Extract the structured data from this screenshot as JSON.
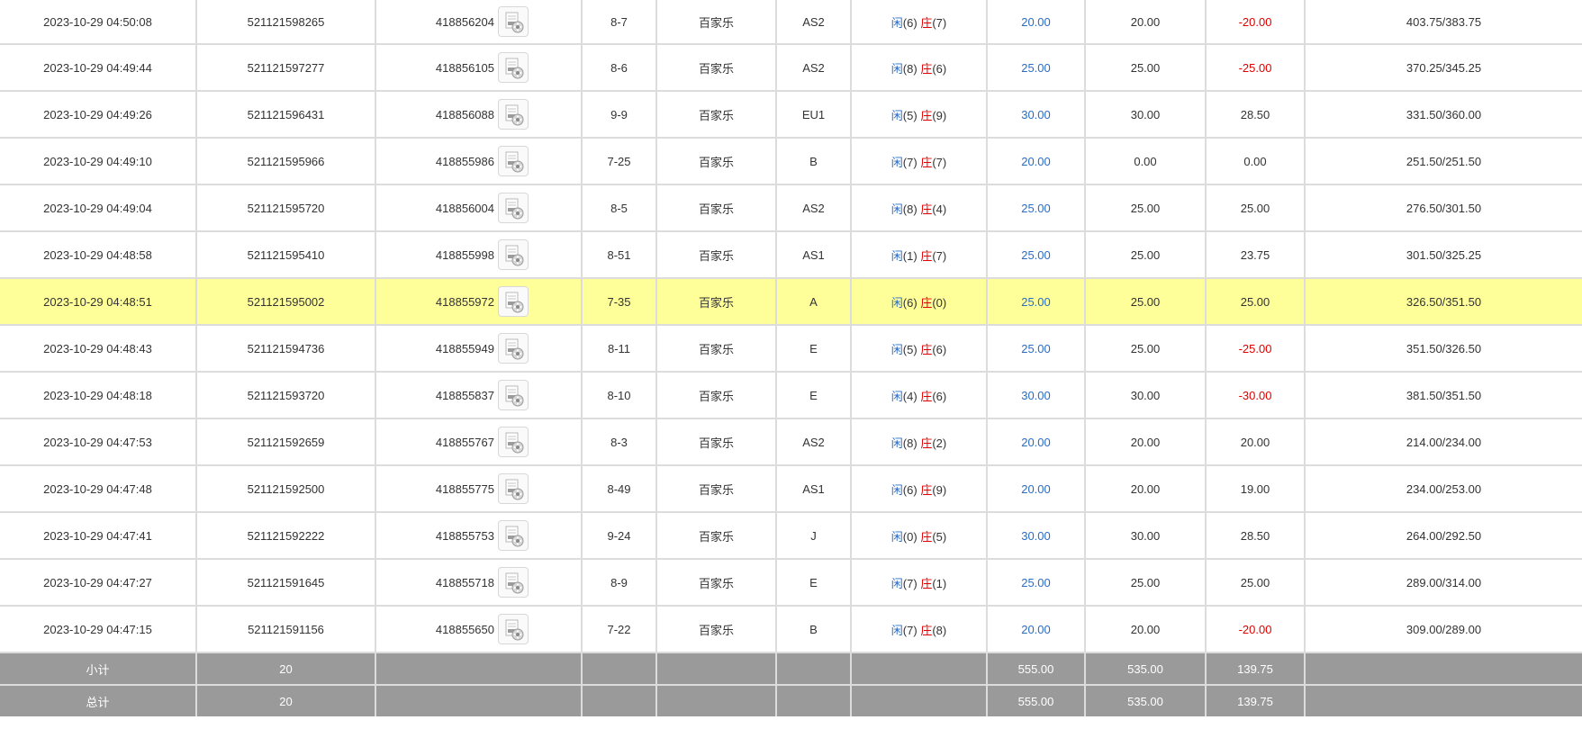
{
  "summary": {
    "subtotal": {
      "label": "小计",
      "count": "20",
      "bet": "555.00",
      "valid": "535.00",
      "winloss": "139.75"
    },
    "total": {
      "label": "总计",
      "count": "20",
      "bet": "555.00",
      "valid": "535.00",
      "winloss": "139.75"
    }
  },
  "labels": {
    "player": "闲",
    "banker": "庄"
  },
  "icons": {
    "round_detail": "video-replay-icon"
  },
  "colors": {
    "highlight": "#ffff99",
    "player": "#2b6cc4",
    "banker": "#e00000",
    "summary_bg": "#9a9a9a"
  },
  "rows": [
    {
      "time": "2023-10-29 04:50:08",
      "bet_id": "521121598265",
      "round_id": "418856204",
      "shoe": "8-7",
      "game": "百家乐",
      "table": "AS2",
      "player_score": "(6)",
      "banker_score": "(7)",
      "bet": "20.00",
      "valid": "20.00",
      "winloss": "-20.00",
      "negative": true,
      "balance": "403.75/383.75",
      "highlight": false
    },
    {
      "time": "2023-10-29 04:49:44",
      "bet_id": "521121597277",
      "round_id": "418856105",
      "shoe": "8-6",
      "game": "百家乐",
      "table": "AS2",
      "player_score": "(8)",
      "banker_score": "(6)",
      "bet": "25.00",
      "valid": "25.00",
      "winloss": "-25.00",
      "negative": true,
      "balance": "370.25/345.25",
      "highlight": false
    },
    {
      "time": "2023-10-29 04:49:26",
      "bet_id": "521121596431",
      "round_id": "418856088",
      "shoe": "9-9",
      "game": "百家乐",
      "table": "EU1",
      "player_score": "(5)",
      "banker_score": "(9)",
      "bet": "30.00",
      "valid": "30.00",
      "winloss": "28.50",
      "negative": false,
      "balance": "331.50/360.00",
      "highlight": false
    },
    {
      "time": "2023-10-29 04:49:10",
      "bet_id": "521121595966",
      "round_id": "418855986",
      "shoe": "7-25",
      "game": "百家乐",
      "table": "B",
      "player_score": "(7)",
      "banker_score": "(7)",
      "bet": "20.00",
      "valid": "0.00",
      "winloss": "0.00",
      "negative": false,
      "balance": "251.50/251.50",
      "highlight": false
    },
    {
      "time": "2023-10-29 04:49:04",
      "bet_id": "521121595720",
      "round_id": "418856004",
      "shoe": "8-5",
      "game": "百家乐",
      "table": "AS2",
      "player_score": "(8)",
      "banker_score": "(4)",
      "bet": "25.00",
      "valid": "25.00",
      "winloss": "25.00",
      "negative": false,
      "balance": "276.50/301.50",
      "highlight": false
    },
    {
      "time": "2023-10-29 04:48:58",
      "bet_id": "521121595410",
      "round_id": "418855998",
      "shoe": "8-51",
      "game": "百家乐",
      "table": "AS1",
      "player_score": "(1)",
      "banker_score": "(7)",
      "bet": "25.00",
      "valid": "25.00",
      "winloss": "23.75",
      "negative": false,
      "balance": "301.50/325.25",
      "highlight": false
    },
    {
      "time": "2023-10-29 04:48:51",
      "bet_id": "521121595002",
      "round_id": "418855972",
      "shoe": "7-35",
      "game": "百家乐",
      "table": "A",
      "player_score": "(6)",
      "banker_score": "(0)",
      "bet": "25.00",
      "valid": "25.00",
      "winloss": "25.00",
      "negative": false,
      "balance": "326.50/351.50",
      "highlight": true
    },
    {
      "time": "2023-10-29 04:48:43",
      "bet_id": "521121594736",
      "round_id": "418855949",
      "shoe": "8-11",
      "game": "百家乐",
      "table": "E",
      "player_score": "(5)",
      "banker_score": "(6)",
      "bet": "25.00",
      "valid": "25.00",
      "winloss": "-25.00",
      "negative": true,
      "balance": "351.50/326.50",
      "highlight": false
    },
    {
      "time": "2023-10-29 04:48:18",
      "bet_id": "521121593720",
      "round_id": "418855837",
      "shoe": "8-10",
      "game": "百家乐",
      "table": "E",
      "player_score": "(4)",
      "banker_score": "(6)",
      "bet": "30.00",
      "valid": "30.00",
      "winloss": "-30.00",
      "negative": true,
      "balance": "381.50/351.50",
      "highlight": false
    },
    {
      "time": "2023-10-29 04:47:53",
      "bet_id": "521121592659",
      "round_id": "418855767",
      "shoe": "8-3",
      "game": "百家乐",
      "table": "AS2",
      "player_score": "(8)",
      "banker_score": "(2)",
      "bet": "20.00",
      "valid": "20.00",
      "winloss": "20.00",
      "negative": false,
      "balance": "214.00/234.00",
      "highlight": false
    },
    {
      "time": "2023-10-29 04:47:48",
      "bet_id": "521121592500",
      "round_id": "418855775",
      "shoe": "8-49",
      "game": "百家乐",
      "table": "AS1",
      "player_score": "(6)",
      "banker_score": "(9)",
      "bet": "20.00",
      "valid": "20.00",
      "winloss": "19.00",
      "negative": false,
      "balance": "234.00/253.00",
      "highlight": false
    },
    {
      "time": "2023-10-29 04:47:41",
      "bet_id": "521121592222",
      "round_id": "418855753",
      "shoe": "9-24",
      "game": "百家乐",
      "table": "J",
      "player_score": "(0)",
      "banker_score": "(5)",
      "bet": "30.00",
      "valid": "30.00",
      "winloss": "28.50",
      "negative": false,
      "balance": "264.00/292.50",
      "highlight": false
    },
    {
      "time": "2023-10-29 04:47:27",
      "bet_id": "521121591645",
      "round_id": "418855718",
      "shoe": "8-9",
      "game": "百家乐",
      "table": "E",
      "player_score": "(7)",
      "banker_score": "(1)",
      "bet": "25.00",
      "valid": "25.00",
      "winloss": "25.00",
      "negative": false,
      "balance": "289.00/314.00",
      "highlight": false
    },
    {
      "time": "2023-10-29 04:47:15",
      "bet_id": "521121591156",
      "round_id": "418855650",
      "shoe": "7-22",
      "game": "百家乐",
      "table": "B",
      "player_score": "(7)",
      "banker_score": "(8)",
      "bet": "20.00",
      "valid": "20.00",
      "winloss": "-20.00",
      "negative": true,
      "balance": "309.00/289.00",
      "highlight": false
    }
  ]
}
